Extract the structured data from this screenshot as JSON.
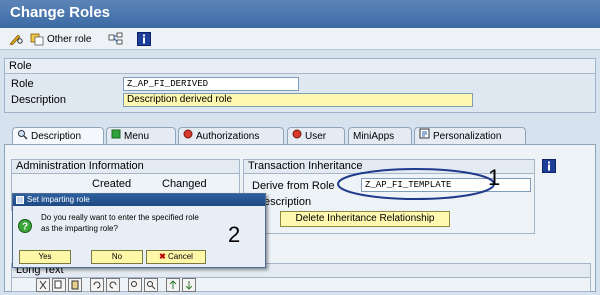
{
  "title": "Change Roles",
  "toolbar": {
    "other_role_label": "Other role"
  },
  "role_section": {
    "header": "Role",
    "role_label": "Role",
    "role_value": "Z_AP_FI_DERIVED",
    "description_label": "Description",
    "description_value": "Description derived role"
  },
  "tabs": [
    {
      "label": "Description"
    },
    {
      "label": "Menu"
    },
    {
      "label": "Authorizations"
    },
    {
      "label": "User"
    },
    {
      "label": "MiniApps"
    },
    {
      "label": "Personalization"
    }
  ],
  "admin_info": {
    "header": "Administration Information",
    "created_label": "Created",
    "changed_label": "Changed"
  },
  "transaction_inheritance": {
    "header": "Transaction Inheritance",
    "derive_label": "Derive from Role",
    "derive_value": "Z_AP_FI_TEMPLATE",
    "description_partial": "escription",
    "delete_button": "Delete Inheritance Relationship"
  },
  "long_text": {
    "header": "Long Text"
  },
  "dialog": {
    "title": "Set imparting role",
    "message_line1": "Do you really want to enter the specified role",
    "message_line2": "as the imparting role?",
    "yes_label": "Yes",
    "no_label": "No",
    "cancel_label": "Cancel"
  },
  "annotations": {
    "one": "1",
    "two": "2"
  },
  "colors": {
    "title_bar": "#3b6aa5",
    "highlight_field": "#fff8b0",
    "dialog_title": "#1e4a82",
    "annotation_ring": "#1f3a8a"
  }
}
